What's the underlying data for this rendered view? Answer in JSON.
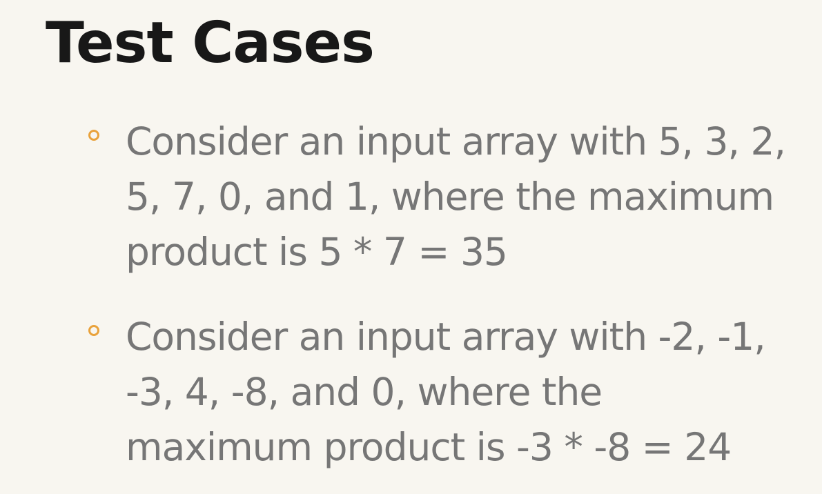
{
  "slide": {
    "title": "Test Cases",
    "accent_color": "#e9a23b",
    "bullets": [
      {
        "lines": [
          "Consider an input array with 5, 3, 2,",
          "5, 7, 0, and 1, where the maximum",
          "product is 5 * 7 = 35"
        ]
      },
      {
        "lines": [
          "Consider an input array with -2, -1,",
          "-3, 4, -8, and 0, where the",
          "maximum product is -3 * -8 = 24"
        ]
      }
    ]
  }
}
